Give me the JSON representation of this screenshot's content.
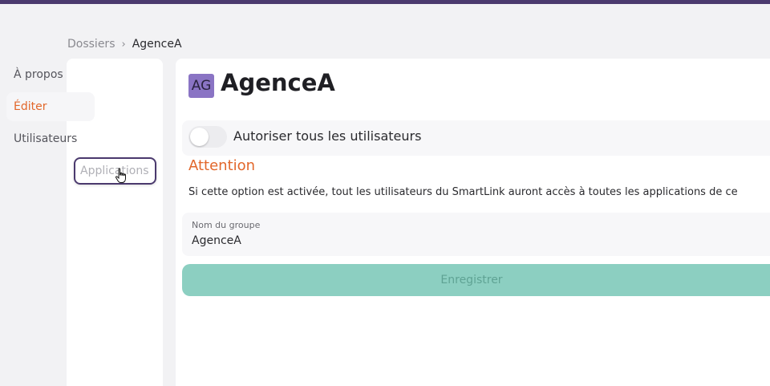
{
  "breadcrumb": {
    "parent": "Dossiers",
    "separator": "›",
    "current": "AgenceA"
  },
  "sidebar": {
    "items": [
      {
        "label": "À propos",
        "state": "default"
      },
      {
        "label": "Éditer",
        "state": "active"
      },
      {
        "label": "Utilisateurs",
        "state": "default"
      },
      {
        "label": "Applications",
        "state": "hovered"
      }
    ]
  },
  "header": {
    "avatar_initials": "AG",
    "title": "AgenceA"
  },
  "settings": {
    "toggle_label": "Autoriser tous les utilisateurs",
    "toggle_on": false,
    "attention_title": "Attention",
    "warning_text": "Si cette option est activée, tout les utilisateurs du SmartLink auront accès à toutes les applications de ce"
  },
  "form": {
    "group_name_label": "Nom du groupe",
    "group_name_value": "AgenceA",
    "save_label": "Enregistrer"
  },
  "colors": {
    "accent": "#e2672b",
    "brand": "#4b3a6e",
    "avatar": "#8a74c4",
    "save_button": "#8ccfc1"
  },
  "icons": {
    "cursor": "hand-pointer-icon",
    "breadcrumb_separator": "chevron-right-icon"
  }
}
